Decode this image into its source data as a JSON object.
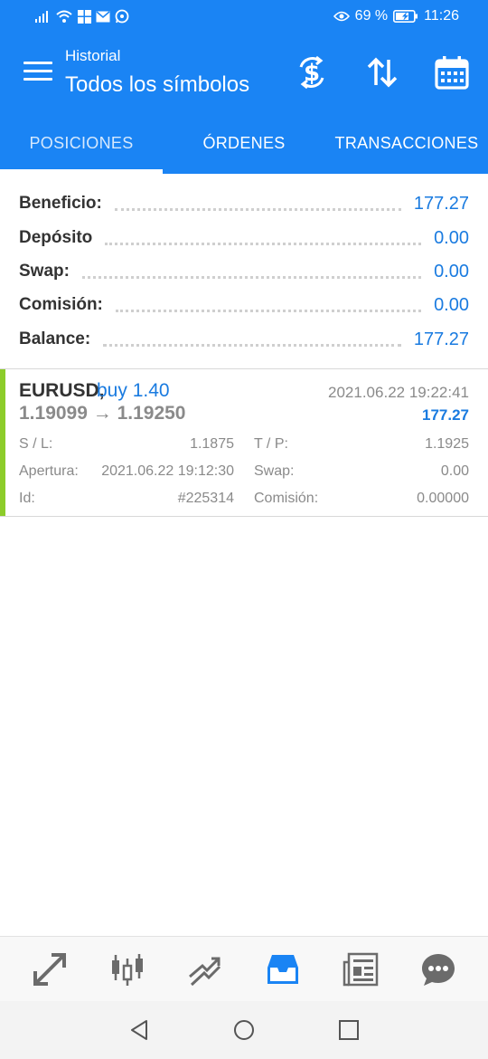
{
  "status_bar": {
    "battery_percent": "69 %",
    "time": "11:26"
  },
  "app_bar": {
    "subtitle": "Historial",
    "title": "Todos los símbolos"
  },
  "tabs": [
    {
      "label": "POSICIONES",
      "active": true
    },
    {
      "label": "ÓRDENES",
      "active": false
    },
    {
      "label": "TRANSACCIONES",
      "active": false
    }
  ],
  "summary": [
    {
      "label": "Beneficio:",
      "value": "177.27"
    },
    {
      "label": "Depósito",
      "value": "0.00"
    },
    {
      "label": "Swap:",
      "value": "0.00"
    },
    {
      "label": "Comisión:",
      "value": "0.00"
    },
    {
      "label": "Balance:",
      "value": "177.27"
    }
  ],
  "position": {
    "symbol": "EURUSD,",
    "side": "buy 1.40",
    "prices": "1.19099 → 1.19250",
    "datetime": "2021.06.22 19:22:41",
    "profit": "177.27",
    "sl_label": "S / L:",
    "sl_value": "1.1875",
    "tp_label": "T / P:",
    "tp_value": "1.1925",
    "open_label": "Apertura:",
    "open_value": "2021.06.22 19:12:30",
    "swap_label": "Swap:",
    "swap_value": "0.00",
    "id_label": "Id:",
    "id_value": "#225314",
    "commission_label": "Comisión:",
    "commission_value": "0.00000",
    "accent_color": "#8ccc2a"
  },
  "bottom_nav": [
    {
      "icon": "quotes-icon",
      "active": false
    },
    {
      "icon": "chart-candles-icon",
      "active": false
    },
    {
      "icon": "trade-icon",
      "active": false
    },
    {
      "icon": "history-inbox-icon",
      "active": true
    },
    {
      "icon": "news-icon",
      "active": false
    },
    {
      "icon": "chat-icon",
      "active": false
    }
  ],
  "colors": {
    "primary": "#1a84f4",
    "value_blue": "#1a7be0",
    "profit_green_bar": "#8ccc2a"
  }
}
